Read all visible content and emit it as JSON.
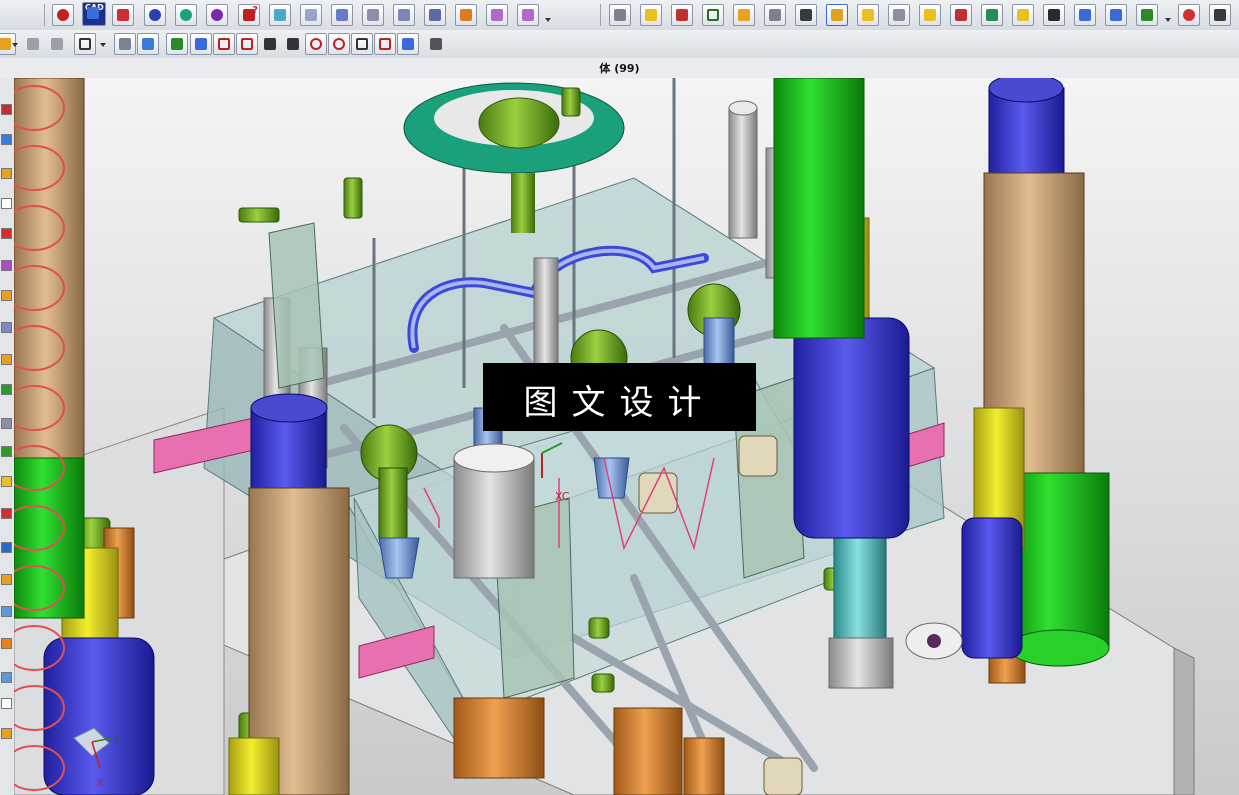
{
  "window": {
    "title": "体 (99)"
  },
  "toolbar": {
    "cad_icon_label": "CAD",
    "question_icon_label": "?"
  },
  "viewport": {
    "csys_label": "XC",
    "triad_y_label": "Y",
    "triad_x_label": "X"
  },
  "watermark": {
    "text": "图文设计"
  },
  "colors": {
    "plate_gray": "#d8dadc",
    "plate_translucent": "#a8c8c8",
    "pillar_tan": "#c9a277",
    "pillar_green": "#1fc41f",
    "pillar_yellow": "#e8e01a",
    "spring_blue": "#3b3bd8",
    "cap_blue": "#4a4ad0",
    "ring_green": "#1aa07a",
    "slider_cyan": "#5ac8c8",
    "pad_pink": "#e870b0",
    "orange": "#e08a30",
    "bolt_gray": "#cfc9b8"
  }
}
